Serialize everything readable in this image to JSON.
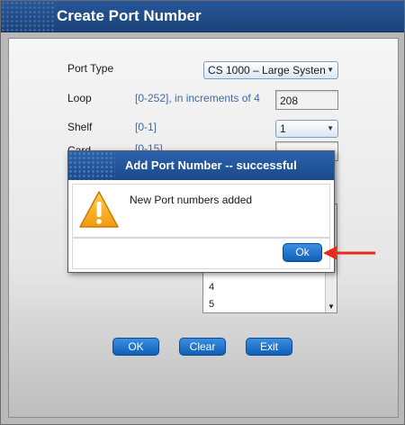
{
  "window": {
    "title": "Create Port Number"
  },
  "form": {
    "port_type": {
      "label": "Port Type",
      "value": "CS 1000 – Large Systen"
    },
    "loop": {
      "label": "Loop",
      "hint": "[0-252], in increments of 4",
      "value": "208"
    },
    "shelf": {
      "label": "Shelf",
      "hint": "[0-1]",
      "value": "1"
    },
    "card": {
      "label": "Card",
      "hint": "[0-15]"
    },
    "list": {
      "items": [
        "4",
        "5"
      ]
    }
  },
  "buttons": {
    "ok": "OK",
    "clear": "Clear",
    "exit": "Exit"
  },
  "dialog": {
    "title": "Add Port Number -- successful",
    "message": "New Port numbers added",
    "ok_label": "Ok",
    "icon": "warning-icon"
  },
  "colors": {
    "title_bar": "#1f4a87",
    "button": "#1a6fcc",
    "annotation_arrow": "#e52b1e"
  }
}
